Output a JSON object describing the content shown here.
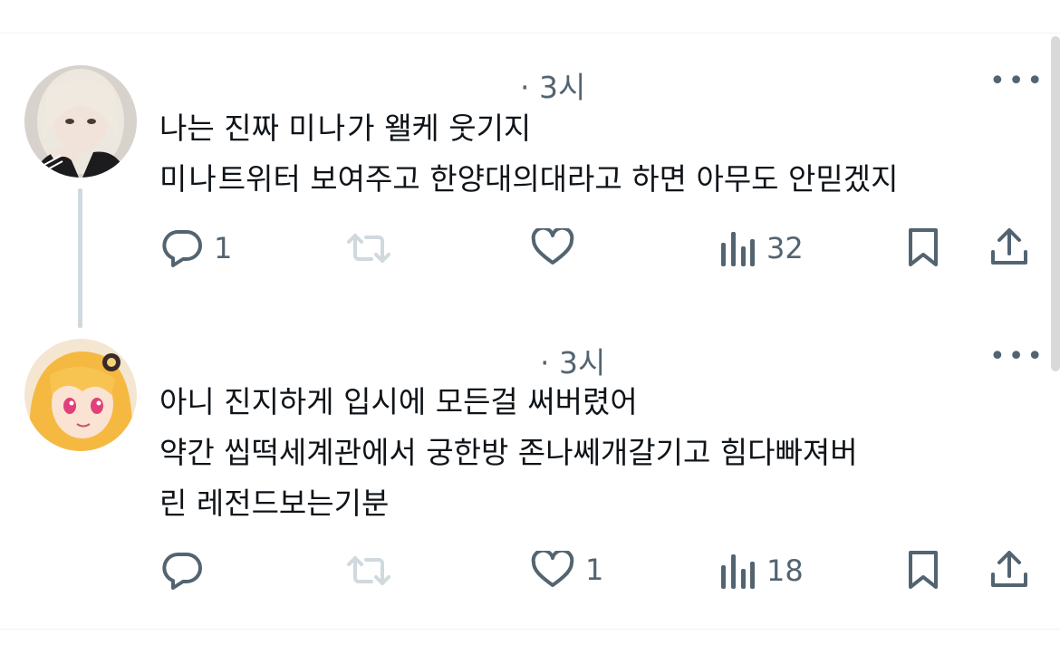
{
  "posts": [
    {
      "time": "· 3시",
      "more_label": "•••",
      "lines": [
        "나는 진짜 ",
        "가 왤케 웃기지",
        "트위터 보여주고 한양대의대라고 하면 아무도 안믿겠지"
      ],
      "scribble": [
        "미나",
        "미나"
      ],
      "actions": {
        "reply_count": "1",
        "retweet_count": "",
        "like_count": "",
        "views": "32"
      }
    },
    {
      "time": "· 3시",
      "more_label": "•••",
      "lines": [
        "아니 진지하게 입시에 모든걸 써버렸어",
        "약간 씹떡세계관에서 궁한방 존나쎄개갈기고 힘다빠져버",
        "린 레전드보는기분"
      ],
      "actions": {
        "reply_count": "",
        "retweet_count": "",
        "like_count": "1",
        "views": "18"
      }
    }
  ],
  "icons": {
    "reply": "reply-icon",
    "retweet": "retweet-icon",
    "like": "heart-icon",
    "views": "views-bar-chart-icon",
    "bookmark": "bookmark-icon",
    "share": "share-icon"
  },
  "colors": {
    "icon_gray": "#536471",
    "retweet_disabled": "#cfd9de",
    "divider": "#eff3f4",
    "thread_line": "#cfd9de"
  }
}
